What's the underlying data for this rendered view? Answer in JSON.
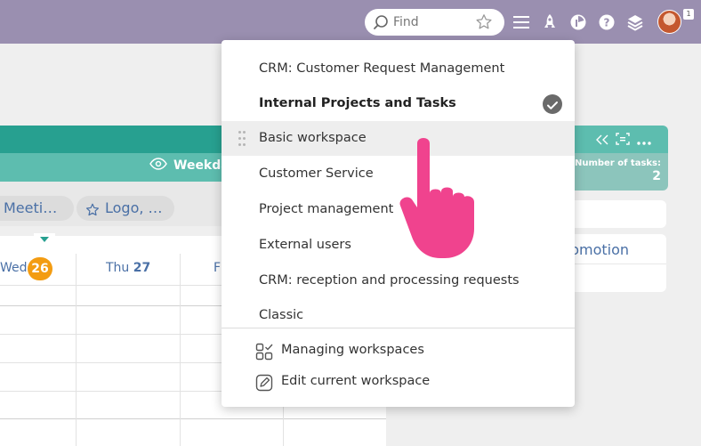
{
  "header": {
    "search": {
      "placeholder": "Find"
    },
    "avatar_badge": "1"
  },
  "background": {
    "view_label": "Weekda",
    "chips": [
      "Meeti…",
      "Logo, …"
    ],
    "days": [
      {
        "label": "Wed",
        "date": "26"
      },
      {
        "label": "Thu",
        "date": "27"
      },
      {
        "label": "F"
      }
    ],
    "column": {
      "tasks_label": "Number of tasks:",
      "tasks_count": "2"
    },
    "card_text": "romotion"
  },
  "menu": {
    "items": [
      {
        "label": "CRM: Customer Request Management"
      },
      {
        "label": "Internal Projects and Tasks"
      },
      {
        "label": "Basic workspace"
      },
      {
        "label": "Customer Service"
      },
      {
        "label": "Project management"
      },
      {
        "label": "External users"
      },
      {
        "label": "CRM: reception and processing requests"
      },
      {
        "label": "Classic"
      }
    ],
    "actions": [
      {
        "label": "Managing workspaces"
      },
      {
        "label": "Edit current workspace"
      }
    ]
  },
  "colors": {
    "topbar": "#9a8fb0",
    "teal": "#27a090",
    "accent_orange": "#f39c12",
    "link_blue": "#4a70a6",
    "hand": "#f0438e"
  },
  "icons": [
    "search-icon",
    "star-icon",
    "menu-icon",
    "rocket-icon",
    "stats-icon",
    "help-icon",
    "layers-icon",
    "eye-icon",
    "checkmark-icon",
    "workspaces-icon",
    "edit-icon",
    "pointer-hand-icon"
  ]
}
